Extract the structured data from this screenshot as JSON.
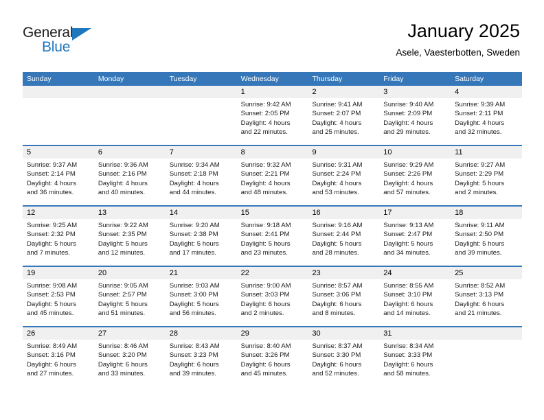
{
  "brand": {
    "line1": "General",
    "line2": "Blue",
    "accent_color": "#1f77bd"
  },
  "header": {
    "title": "January 2025",
    "subtitle": "Asele, Vaesterbotten, Sweden"
  },
  "theme": {
    "header_blue": "#3577b9",
    "day_band_gray": "#f0f0f0",
    "text_color": "#000000"
  },
  "weekdays": [
    "Sunday",
    "Monday",
    "Tuesday",
    "Wednesday",
    "Thursday",
    "Friday",
    "Saturday"
  ],
  "weeks": [
    [
      {
        "day": "",
        "lines": []
      },
      {
        "day": "",
        "lines": []
      },
      {
        "day": "",
        "lines": []
      },
      {
        "day": "1",
        "lines": [
          "Sunrise: 9:42 AM",
          "Sunset: 2:05 PM",
          "Daylight: 4 hours",
          "and 22 minutes."
        ]
      },
      {
        "day": "2",
        "lines": [
          "Sunrise: 9:41 AM",
          "Sunset: 2:07 PM",
          "Daylight: 4 hours",
          "and 25 minutes."
        ]
      },
      {
        "day": "3",
        "lines": [
          "Sunrise: 9:40 AM",
          "Sunset: 2:09 PM",
          "Daylight: 4 hours",
          "and 29 minutes."
        ]
      },
      {
        "day": "4",
        "lines": [
          "Sunrise: 9:39 AM",
          "Sunset: 2:11 PM",
          "Daylight: 4 hours",
          "and 32 minutes."
        ]
      }
    ],
    [
      {
        "day": "5",
        "lines": [
          "Sunrise: 9:37 AM",
          "Sunset: 2:14 PM",
          "Daylight: 4 hours",
          "and 36 minutes."
        ]
      },
      {
        "day": "6",
        "lines": [
          "Sunrise: 9:36 AM",
          "Sunset: 2:16 PM",
          "Daylight: 4 hours",
          "and 40 minutes."
        ]
      },
      {
        "day": "7",
        "lines": [
          "Sunrise: 9:34 AM",
          "Sunset: 2:18 PM",
          "Daylight: 4 hours",
          "and 44 minutes."
        ]
      },
      {
        "day": "8",
        "lines": [
          "Sunrise: 9:32 AM",
          "Sunset: 2:21 PM",
          "Daylight: 4 hours",
          "and 48 minutes."
        ]
      },
      {
        "day": "9",
        "lines": [
          "Sunrise: 9:31 AM",
          "Sunset: 2:24 PM",
          "Daylight: 4 hours",
          "and 53 minutes."
        ]
      },
      {
        "day": "10",
        "lines": [
          "Sunrise: 9:29 AM",
          "Sunset: 2:26 PM",
          "Daylight: 4 hours",
          "and 57 minutes."
        ]
      },
      {
        "day": "11",
        "lines": [
          "Sunrise: 9:27 AM",
          "Sunset: 2:29 PM",
          "Daylight: 5 hours",
          "and 2 minutes."
        ]
      }
    ],
    [
      {
        "day": "12",
        "lines": [
          "Sunrise: 9:25 AM",
          "Sunset: 2:32 PM",
          "Daylight: 5 hours",
          "and 7 minutes."
        ]
      },
      {
        "day": "13",
        "lines": [
          "Sunrise: 9:22 AM",
          "Sunset: 2:35 PM",
          "Daylight: 5 hours",
          "and 12 minutes."
        ]
      },
      {
        "day": "14",
        "lines": [
          "Sunrise: 9:20 AM",
          "Sunset: 2:38 PM",
          "Daylight: 5 hours",
          "and 17 minutes."
        ]
      },
      {
        "day": "15",
        "lines": [
          "Sunrise: 9:18 AM",
          "Sunset: 2:41 PM",
          "Daylight: 5 hours",
          "and 23 minutes."
        ]
      },
      {
        "day": "16",
        "lines": [
          "Sunrise: 9:16 AM",
          "Sunset: 2:44 PM",
          "Daylight: 5 hours",
          "and 28 minutes."
        ]
      },
      {
        "day": "17",
        "lines": [
          "Sunrise: 9:13 AM",
          "Sunset: 2:47 PM",
          "Daylight: 5 hours",
          "and 34 minutes."
        ]
      },
      {
        "day": "18",
        "lines": [
          "Sunrise: 9:11 AM",
          "Sunset: 2:50 PM",
          "Daylight: 5 hours",
          "and 39 minutes."
        ]
      }
    ],
    [
      {
        "day": "19",
        "lines": [
          "Sunrise: 9:08 AM",
          "Sunset: 2:53 PM",
          "Daylight: 5 hours",
          "and 45 minutes."
        ]
      },
      {
        "day": "20",
        "lines": [
          "Sunrise: 9:05 AM",
          "Sunset: 2:57 PM",
          "Daylight: 5 hours",
          "and 51 minutes."
        ]
      },
      {
        "day": "21",
        "lines": [
          "Sunrise: 9:03 AM",
          "Sunset: 3:00 PM",
          "Daylight: 5 hours",
          "and 56 minutes."
        ]
      },
      {
        "day": "22",
        "lines": [
          "Sunrise: 9:00 AM",
          "Sunset: 3:03 PM",
          "Daylight: 6 hours",
          "and 2 minutes."
        ]
      },
      {
        "day": "23",
        "lines": [
          "Sunrise: 8:57 AM",
          "Sunset: 3:06 PM",
          "Daylight: 6 hours",
          "and 8 minutes."
        ]
      },
      {
        "day": "24",
        "lines": [
          "Sunrise: 8:55 AM",
          "Sunset: 3:10 PM",
          "Daylight: 6 hours",
          "and 14 minutes."
        ]
      },
      {
        "day": "25",
        "lines": [
          "Sunrise: 8:52 AM",
          "Sunset: 3:13 PM",
          "Daylight: 6 hours",
          "and 21 minutes."
        ]
      }
    ],
    [
      {
        "day": "26",
        "lines": [
          "Sunrise: 8:49 AM",
          "Sunset: 3:16 PM",
          "Daylight: 6 hours",
          "and 27 minutes."
        ]
      },
      {
        "day": "27",
        "lines": [
          "Sunrise: 8:46 AM",
          "Sunset: 3:20 PM",
          "Daylight: 6 hours",
          "and 33 minutes."
        ]
      },
      {
        "day": "28",
        "lines": [
          "Sunrise: 8:43 AM",
          "Sunset: 3:23 PM",
          "Daylight: 6 hours",
          "and 39 minutes."
        ]
      },
      {
        "day": "29",
        "lines": [
          "Sunrise: 8:40 AM",
          "Sunset: 3:26 PM",
          "Daylight: 6 hours",
          "and 45 minutes."
        ]
      },
      {
        "day": "30",
        "lines": [
          "Sunrise: 8:37 AM",
          "Sunset: 3:30 PM",
          "Daylight: 6 hours",
          "and 52 minutes."
        ]
      },
      {
        "day": "31",
        "lines": [
          "Sunrise: 8:34 AM",
          "Sunset: 3:33 PM",
          "Daylight: 6 hours",
          "and 58 minutes."
        ]
      },
      {
        "day": "",
        "lines": []
      }
    ]
  ]
}
